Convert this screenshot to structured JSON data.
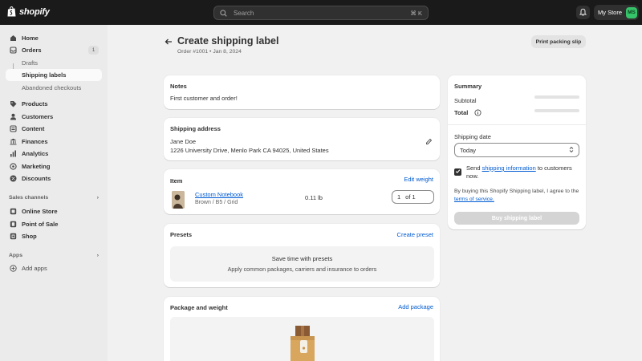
{
  "topbar": {
    "brand": "shopify",
    "search_placeholder": "Search",
    "search_shortcut": "⌘ K",
    "store_name": "My Store",
    "avatar_initials": "MS",
    "avatar_color": "#36c46a"
  },
  "sidebar": {
    "home": "Home",
    "orders": "Orders",
    "orders_count": "1",
    "drafts": "Drafts",
    "shipping_labels": "Shipping labels",
    "abandoned": "Abandoned checkouts",
    "products": "Products",
    "customers": "Customers",
    "content": "Content",
    "finances": "Finances",
    "analytics": "Analytics",
    "marketing": "Marketing",
    "discounts": "Discounts",
    "sales_channels": "Sales channels",
    "online_store": "Online Store",
    "pos": "Point of Sale",
    "shop": "Shop",
    "apps": "Apps",
    "add_apps": "Add apps"
  },
  "header": {
    "title": "Create shipping label",
    "subtitle": "Order #1001 • Jan 8, 2024",
    "print_button": "Print packing slip"
  },
  "notes": {
    "title": "Notes",
    "text": "First customer and order!"
  },
  "address": {
    "title": "Shipping address",
    "name": "Jane Doe",
    "line": "1226 University Drive, Menlo Park CA 94025, United States"
  },
  "item": {
    "title": "Item",
    "edit_link": "Edit weight",
    "product_name": "Custom Notebook",
    "variant": "Brown / B5 / Grid",
    "weight": "0.11 lb",
    "qty": "1",
    "qty_of": "of 1"
  },
  "presets": {
    "title": "Presets",
    "link": "Create preset",
    "empty_title": "Save time with presets",
    "empty_text": "Apply common packages, carriers and insurance to orders"
  },
  "package": {
    "title": "Package and weight",
    "link": "Add package"
  },
  "summary": {
    "title": "Summary",
    "subtotal_label": "Subtotal",
    "total_label": "Total",
    "date_label": "Shipping date",
    "date_value": "Today",
    "send_prefix": "Send",
    "send_link": "shipping information",
    "send_suffix": "to customers now.",
    "terms_prefix": "By buying this Shopify Shipping label, I agree to the",
    "terms_link": "terms of service.",
    "buy_button": "Buy shipping label"
  }
}
